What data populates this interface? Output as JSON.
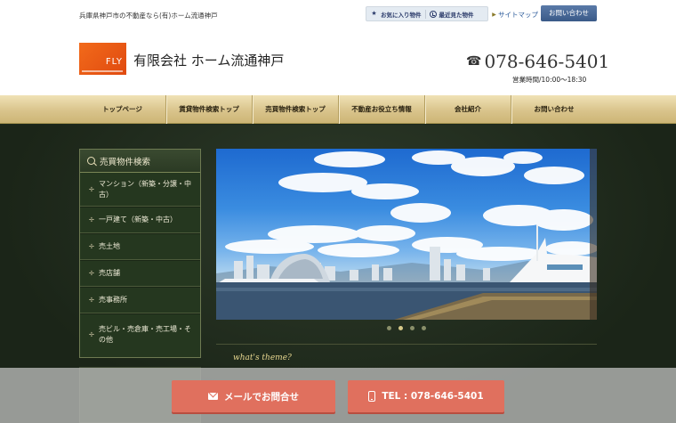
{
  "header": {
    "tagline": "兵庫県神戸市の不動産なら(有)ホーム流通神戸",
    "favorites_label": "お気に入り物件",
    "recent_label": "最近見た物件",
    "sitemap_label": "サイトマップ",
    "contact_label": "お問い合わせ",
    "logo_text": "FLY",
    "company_name": "有限会社 ホーム流通神戸",
    "phone": "078-646-5401",
    "hours": "営業時間/10:00～18:30"
  },
  "nav": {
    "items": [
      {
        "label": "トップページ"
      },
      {
        "label": "賃貸物件検索トップ"
      },
      {
        "label": "売買物件検索トップ"
      },
      {
        "label": "不動産お役立ち情報"
      },
      {
        "label": "会社紹介"
      },
      {
        "label": "お問い合わせ"
      }
    ]
  },
  "sidebar": {
    "title": "売買物件検索",
    "items": [
      {
        "label": "マンション（新築・分譲・中古）"
      },
      {
        "label": "一戸建て（新築・中古）"
      },
      {
        "label": "売土地"
      },
      {
        "label": "売店舗"
      },
      {
        "label": "売事務所"
      },
      {
        "label": "売ビル・売倉庫・売工場・その他"
      }
    ]
  },
  "slider": {
    "count": 4,
    "active_index": 1
  },
  "theme": {
    "title": "what's theme?"
  },
  "bottom_bar": {
    "mail_label": "メールでお問合せ",
    "tel_label": "TEL : 078-646-5401"
  },
  "colors": {
    "accent_orange": "#f26a1a",
    "nav_gold": "#d9c48c",
    "sidebar_green": "#25371f",
    "cta_coral": "#e0705e",
    "contact_blue": "#3a5a88"
  }
}
